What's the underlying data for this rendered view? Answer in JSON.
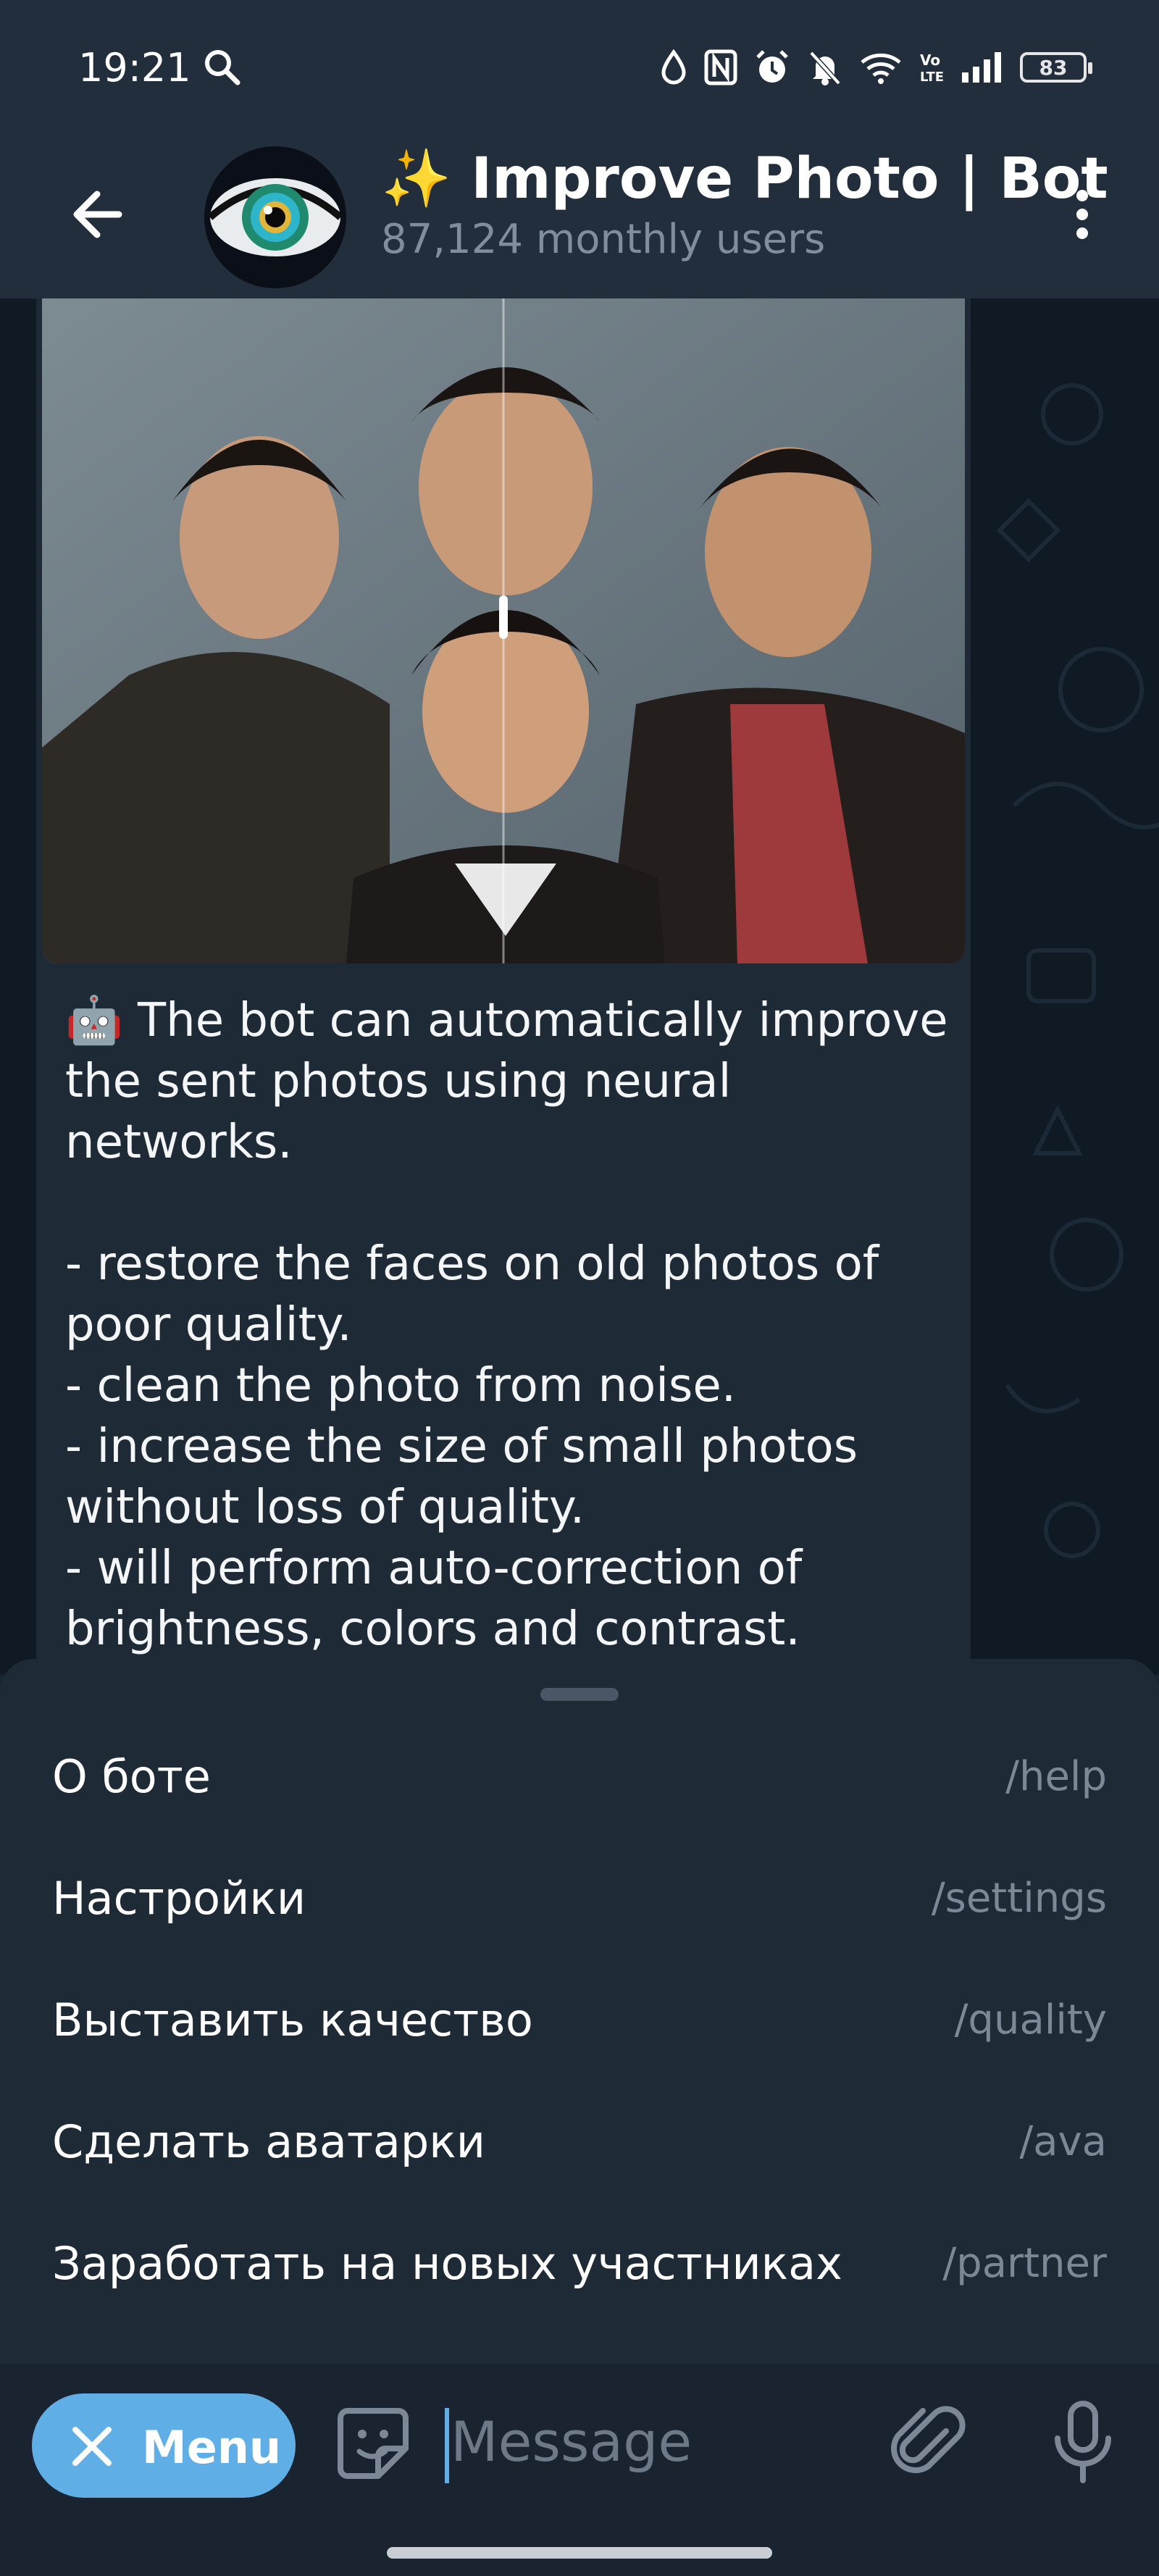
{
  "status_bar": {
    "time": "19:21",
    "battery": "83",
    "icons": [
      "search-icon",
      "drop-icon",
      "nfc-icon",
      "alarm-icon",
      "bell-off-icon",
      "wifi-icon",
      "volte-icon",
      "signal-icon",
      "battery-icon"
    ]
  },
  "header": {
    "title": "✨ Improve Photo | Bot",
    "subtitle": "87,124 monthly users",
    "back_icon": "arrow-left-icon",
    "more_icon": "more-vertical-icon"
  },
  "message": {
    "text": "🤖 The bot can automatically improve the sent photos using neural networks.\n\n- restore the faces on old photos of poor quality.\n- clean the photo from noise.\n- increase the size of small photos without loss of quality.\n- will perform auto-correction of brightness, colors and contrast."
  },
  "commands": [
    {
      "label": "О боте",
      "command": "/help"
    },
    {
      "label": "Настройки",
      "command": "/settings"
    },
    {
      "label": "Выставить качество",
      "command": "/quality"
    },
    {
      "label": "Сделать аватарки",
      "command": "/ava"
    },
    {
      "label": "Заработать на новых участниках",
      "command": "/partner"
    }
  ],
  "input_bar": {
    "menu_label": "Menu",
    "placeholder": "Message"
  },
  "colors": {
    "accent": "#5faee6",
    "header_bg": "#222e3c",
    "sheet_bg": "#1f2a37",
    "chat_bg": "#0f1a25"
  }
}
